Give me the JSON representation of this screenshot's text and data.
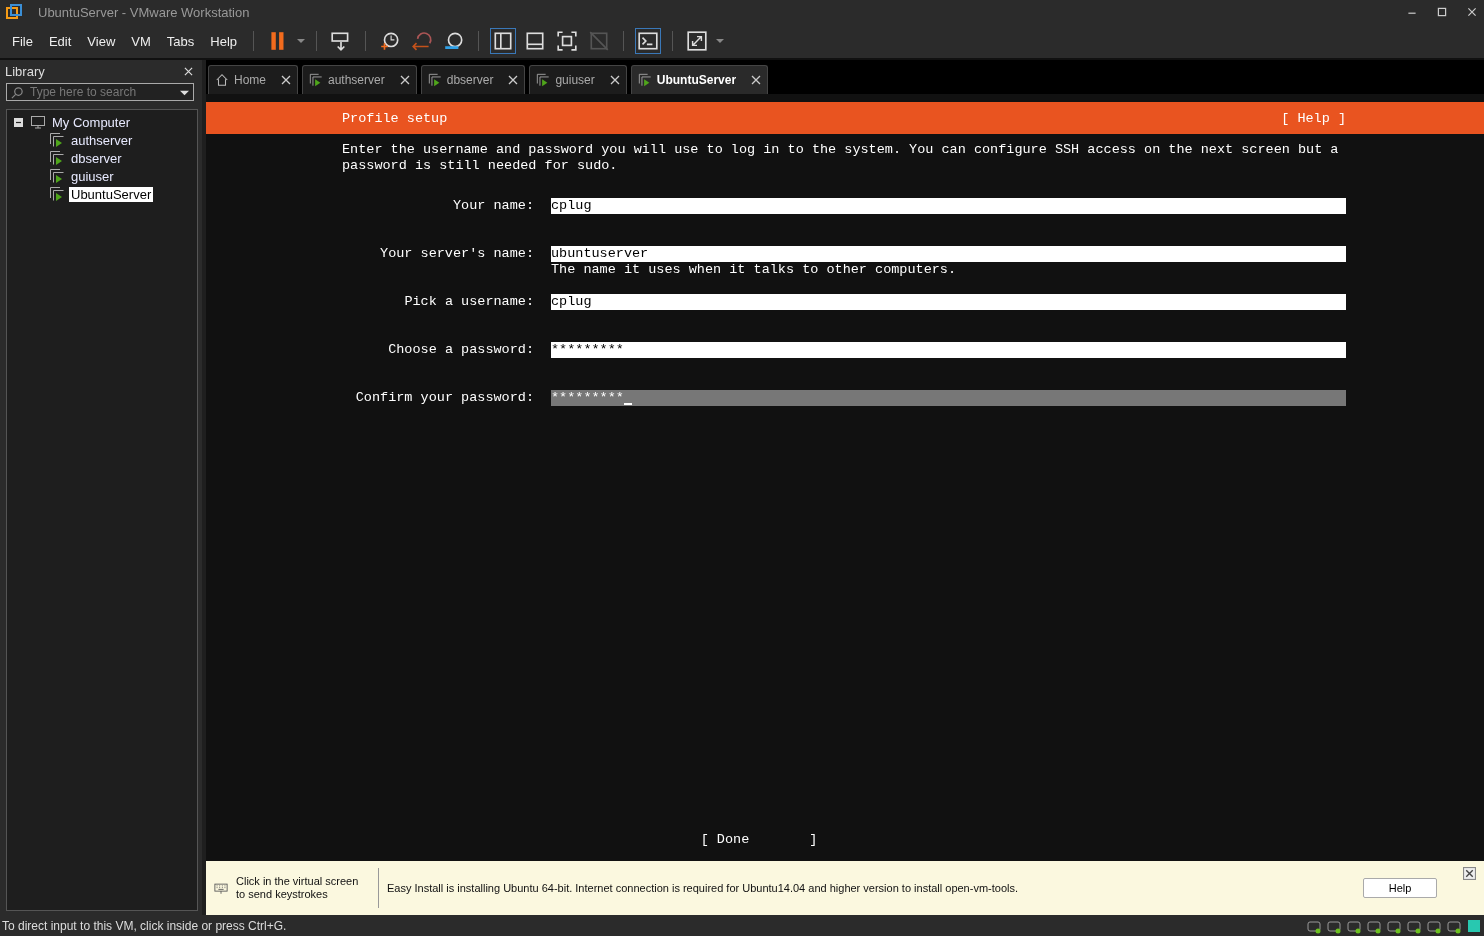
{
  "window": {
    "title": "UbuntuServer - VMware Workstation"
  },
  "menu": [
    "File",
    "Edit",
    "View",
    "VM",
    "Tabs",
    "Help"
  ],
  "library": {
    "title": "Library",
    "search": {
      "placeholder": "Type here to search"
    },
    "tree": [
      {
        "label": "My Computer",
        "expanded": true,
        "selected": false,
        "children": [
          {
            "label": "authserver",
            "selected": false
          },
          {
            "label": "dbserver",
            "selected": false
          },
          {
            "label": "guiuser",
            "selected": false
          },
          {
            "label": "UbuntuServer",
            "selected": true
          }
        ]
      }
    ]
  },
  "tabs": [
    {
      "label": "Home",
      "kind": "home",
      "selected": false
    },
    {
      "label": "authserver",
      "kind": "vm",
      "selected": false
    },
    {
      "label": "dbserver",
      "kind": "vm",
      "selected": false
    },
    {
      "label": "guiuser",
      "kind": "vm",
      "selected": false
    },
    {
      "label": "UbuntuServer",
      "kind": "vm",
      "selected": true
    }
  ],
  "console": {
    "header": {
      "title": "Profile setup",
      "help": "[ Help ]"
    },
    "intro": "Enter the username and password you will use to log in to the system. You can configure SSH access on the next screen but a password is still needed for sudo.",
    "fields": [
      {
        "label": "Your name:",
        "value": "cplug",
        "focused": false
      },
      {
        "label": "Your server's name:",
        "value": "ubuntuserver",
        "focused": false,
        "hint": "The name it uses when it talks to other computers."
      },
      {
        "label": "Pick a username:",
        "value": "cplug",
        "focused": false
      },
      {
        "label": "Choose a password:",
        "value": "*********",
        "focused": false
      },
      {
        "label": "Confirm your password:",
        "value": "*********",
        "focused": true
      }
    ],
    "done_open": "[ Done",
    "done_close": "]"
  },
  "info_bar": {
    "hint": "Click in the virtual screen to send keystrokes",
    "message": "Easy Install is installing Ubuntu 64-bit. Internet connection is required for Ubuntu14.04 and higher version to install open-vm-tools.",
    "button": "Help"
  },
  "status_bar": {
    "text": "To direct input to this VM, click inside or press Ctrl+G."
  }
}
